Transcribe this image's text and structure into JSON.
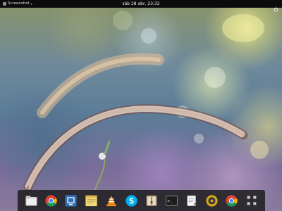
{
  "topbar": {
    "active_app": "Screenshot",
    "clock": "sáb 28 abr, 23:32"
  },
  "dock": {
    "items": [
      {
        "icon": "files-icon"
      },
      {
        "icon": "chrome-icon"
      },
      {
        "icon": "screen-viewer-icon"
      },
      {
        "icon": "notes-icon"
      },
      {
        "icon": "vlc-icon"
      },
      {
        "icon": "skype-icon"
      },
      {
        "icon": "archive-manager-icon"
      },
      {
        "icon": "terminal-icon"
      },
      {
        "icon": "text-editor-icon"
      },
      {
        "icon": "rhythmbox-icon"
      },
      {
        "icon": "chrome-alt-icon"
      },
      {
        "icon": "app-grid-icon"
      }
    ]
  },
  "colors": {
    "topbar": "#0c0c0c",
    "dock": "#181818",
    "terminal_prompt": ">_"
  }
}
